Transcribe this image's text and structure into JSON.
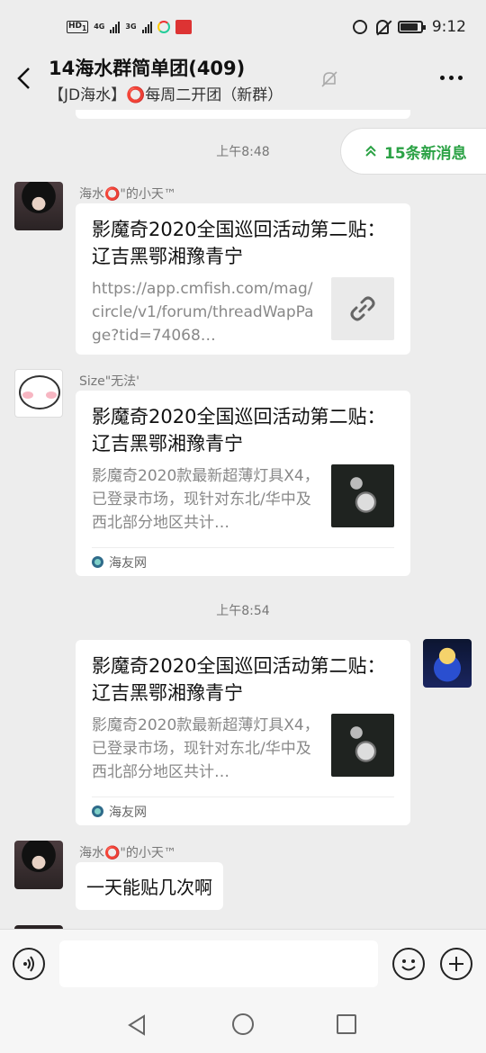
{
  "status_bar": {
    "hd": "HD",
    "hd_sub": "1",
    "net1": "4G",
    "net2": "3G",
    "time": "9:12",
    "battery_level_pct": 85
  },
  "header": {
    "title": "14海水群简单团(409)",
    "subtitle": "【JD海水】⭕每周二开团（新群）",
    "icons": [
      "back-icon",
      "mute-icon",
      "more-icon"
    ]
  },
  "new_messages": {
    "label": "15条新消息",
    "icon": "double-chevron-up-icon"
  },
  "messages": [
    {
      "type": "time",
      "text": "上午8:48"
    },
    {
      "type": "link_card",
      "sender": "海水⭕\"的小天™",
      "title": "影魔奇2020全国巡回活动第二贴： 辽吉黑鄂湘豫青宁",
      "desc": "https://app.cmfish.com/mag/circle/v1/forum/threadWapPage?tid=74068…",
      "thumb_icon": "link-icon"
    },
    {
      "type": "article_card",
      "sender": "Size\"无法'",
      "title": "影魔奇2020全国巡回活动第二贴： 辽吉黑鄂湘豫青宁",
      "desc": "影魔奇2020款最新超薄灯具X4，已登录市场，现针对东北/华中及西北部分地区共计…",
      "source": "海友网"
    },
    {
      "type": "time",
      "text": "上午8:54"
    },
    {
      "type": "article_card_self",
      "title": "影魔奇2020全国巡回活动第二贴： 辽吉黑鄂湘豫青宁",
      "desc": "影魔奇2020款最新超薄灯具X4，已登录市场，现针对东北/华中及西北部分地区共计…",
      "source": "海友网"
    },
    {
      "type": "text",
      "sender": "海水⭕\"的小天™",
      "text": "一天能贴几次啊"
    }
  ],
  "input_bar": {
    "value": "",
    "icons": [
      "voice-icon",
      "emoji-icon",
      "plus-icon"
    ]
  },
  "nav_bar": {
    "icons": [
      "nav-back-icon",
      "nav-home-icon",
      "nav-recent-icon"
    ]
  }
}
